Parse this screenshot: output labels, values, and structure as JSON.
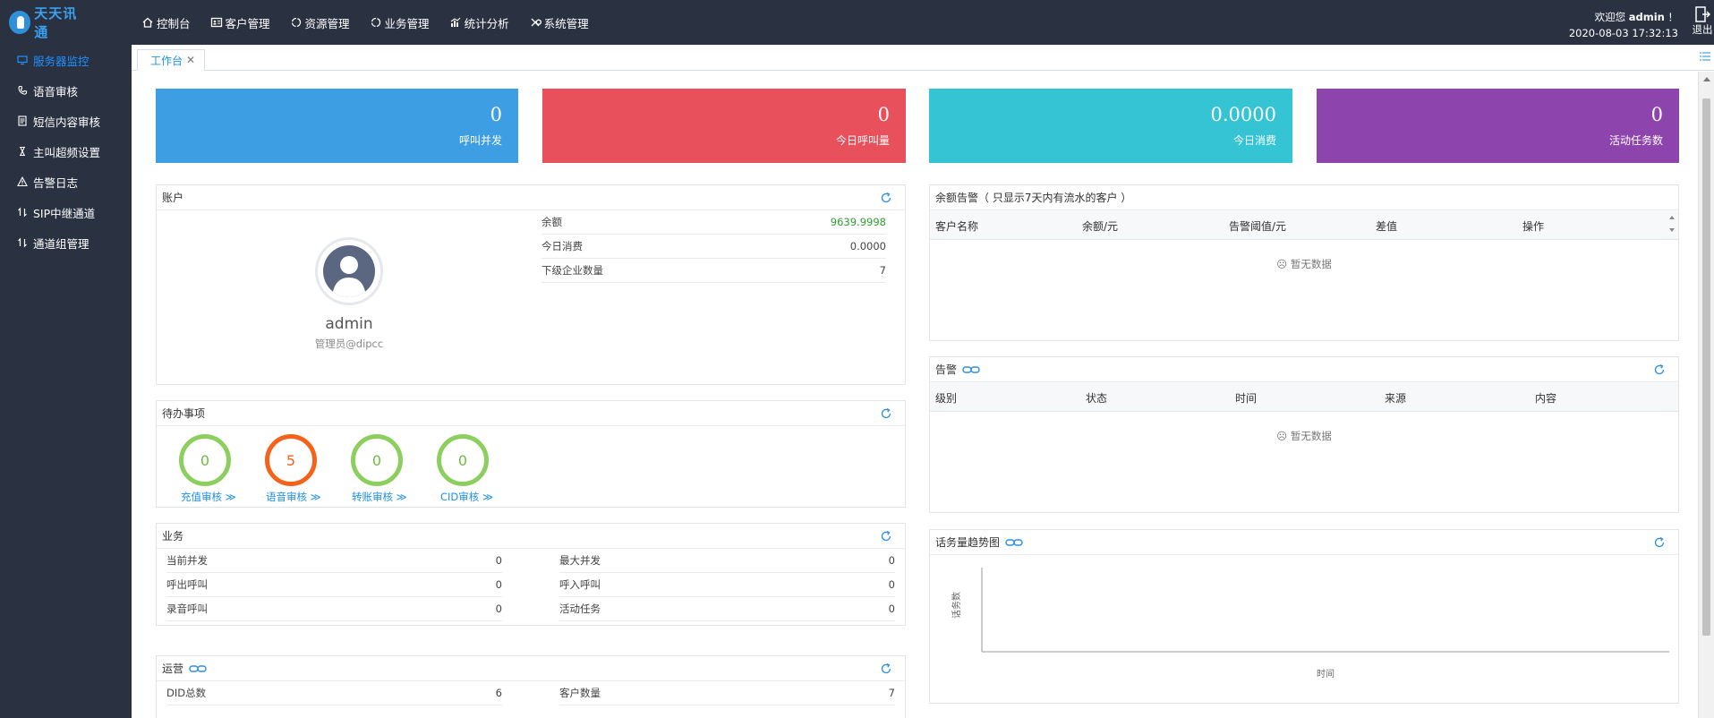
{
  "brand": {
    "logo_text": "天天讯通"
  },
  "topnav": [
    {
      "label": "控制台",
      "icon": "home-icon"
    },
    {
      "label": "客户管理",
      "icon": "contact-card-icon"
    },
    {
      "label": "资源管理",
      "icon": "cycle-icon"
    },
    {
      "label": "业务管理",
      "icon": "cycle-icon"
    },
    {
      "label": "统计分析",
      "icon": "bar-chart-icon"
    },
    {
      "label": "系统管理",
      "icon": "wrench-icon"
    }
  ],
  "user": {
    "welcome_prefix": "欢迎您",
    "name": "admin",
    "welcome_suffix": "！",
    "datetime": "2020-08-03 17:32:13",
    "logout_label": "退出"
  },
  "sidebar": [
    {
      "label": "服务器监控",
      "icon": "monitor-icon",
      "active": true
    },
    {
      "label": "语音审核",
      "icon": "phone-icon"
    },
    {
      "label": "短信内容审核",
      "icon": "document-icon"
    },
    {
      "label": "主叫超频设置",
      "icon": "hourglass-icon"
    },
    {
      "label": "告警日志",
      "icon": "warning-icon"
    },
    {
      "label": "SIP中继通道",
      "icon": "swap-icon"
    },
    {
      "label": "通道组管理",
      "icon": "swap-icon"
    }
  ],
  "tabs": [
    {
      "label": "工作台",
      "close": "✕"
    }
  ],
  "stats": [
    {
      "value": "0",
      "label": "呼叫并发",
      "color": "#3d9ee3"
    },
    {
      "value": "0",
      "label": "今日呼叫量",
      "color": "#e8505b"
    },
    {
      "value": "0.0000",
      "label": "今日消费",
      "color": "#35c4d3"
    },
    {
      "value": "0",
      "label": "活动任务数",
      "color": "#8e44ad"
    }
  ],
  "account": {
    "title": "账户",
    "user_name": "admin",
    "user_role": "管理员@dipcc",
    "rows": [
      {
        "label": "余额",
        "value": "9639.9998"
      },
      {
        "label": "今日消费",
        "value": "0.0000"
      },
      {
        "label": "下级企业数量",
        "value": "7"
      }
    ]
  },
  "todo": {
    "title": "待办事项",
    "items": [
      {
        "count": "0",
        "label": "充值审核",
        "chev": "≫"
      },
      {
        "count": "5",
        "label": "语音审核",
        "chev": "≫"
      },
      {
        "count": "0",
        "label": "转账审核",
        "chev": "≫"
      },
      {
        "count": "0",
        "label": "CID审核",
        "chev": "≫"
      }
    ]
  },
  "business": {
    "title": "业务",
    "left": [
      {
        "label": "当前并发",
        "value": "0"
      },
      {
        "label": "呼出呼叫",
        "value": "0"
      },
      {
        "label": "录音呼叫",
        "value": "0"
      }
    ],
    "right": [
      {
        "label": "最大并发",
        "value": "0"
      },
      {
        "label": "呼入呼叫",
        "value": "0"
      },
      {
        "label": "活动任务",
        "value": "0"
      }
    ]
  },
  "operations": {
    "title": "运营",
    "left": [
      {
        "label": "DID总数",
        "value": "6"
      }
    ],
    "right": [
      {
        "label": "客户数量",
        "value": "7"
      }
    ]
  },
  "balance_alert": {
    "title": "余额告警（ 只显示7天内有流水的客户 ）",
    "columns": [
      "客户名称",
      "余额/元",
      "告警阈值/元",
      "差值",
      "操作"
    ],
    "empty_text": "暂无数据"
  },
  "alarm": {
    "title": "告警",
    "columns": [
      "级别",
      "状态",
      "时间",
      "来源",
      "内容"
    ],
    "empty_text": "暂无数据"
  },
  "trend": {
    "title": "话务量趋势图",
    "chart_data": {
      "type": "line",
      "series": [],
      "xlabel": "时间",
      "ylabel": "话务数"
    }
  }
}
